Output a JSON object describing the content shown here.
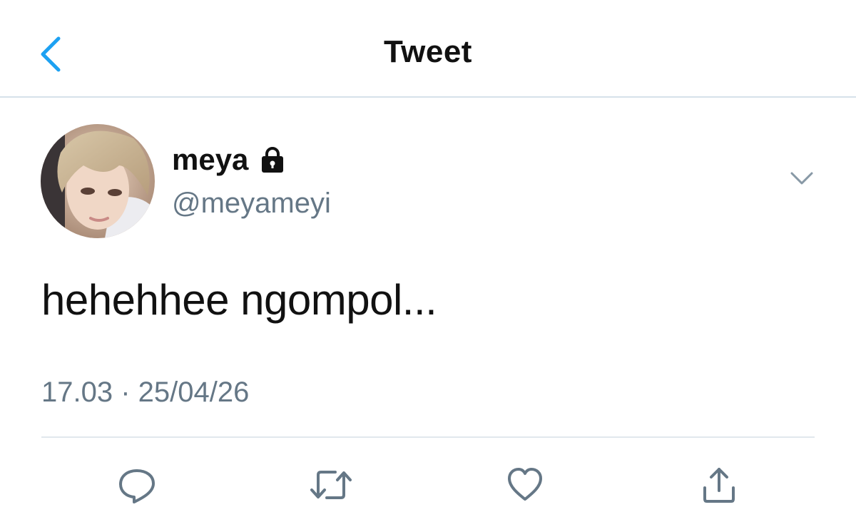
{
  "header": {
    "title": "Tweet",
    "back_icon": "chevron-left-icon"
  },
  "tweet": {
    "display_name": "meya",
    "protected_icon": "lock-icon",
    "handle": "@meyameyi",
    "text": "hehehhee ngompol...",
    "timestamp": "17.03 · 25/04/26"
  },
  "actions": {
    "reply_icon": "reply-icon",
    "retweet_icon": "retweet-icon",
    "like_icon": "heart-icon",
    "share_icon": "share-icon"
  },
  "colors": {
    "accent": "#1da1f2",
    "secondary_text": "#657786",
    "icon_gray": "#657786",
    "divider": "#e1e8ed"
  }
}
